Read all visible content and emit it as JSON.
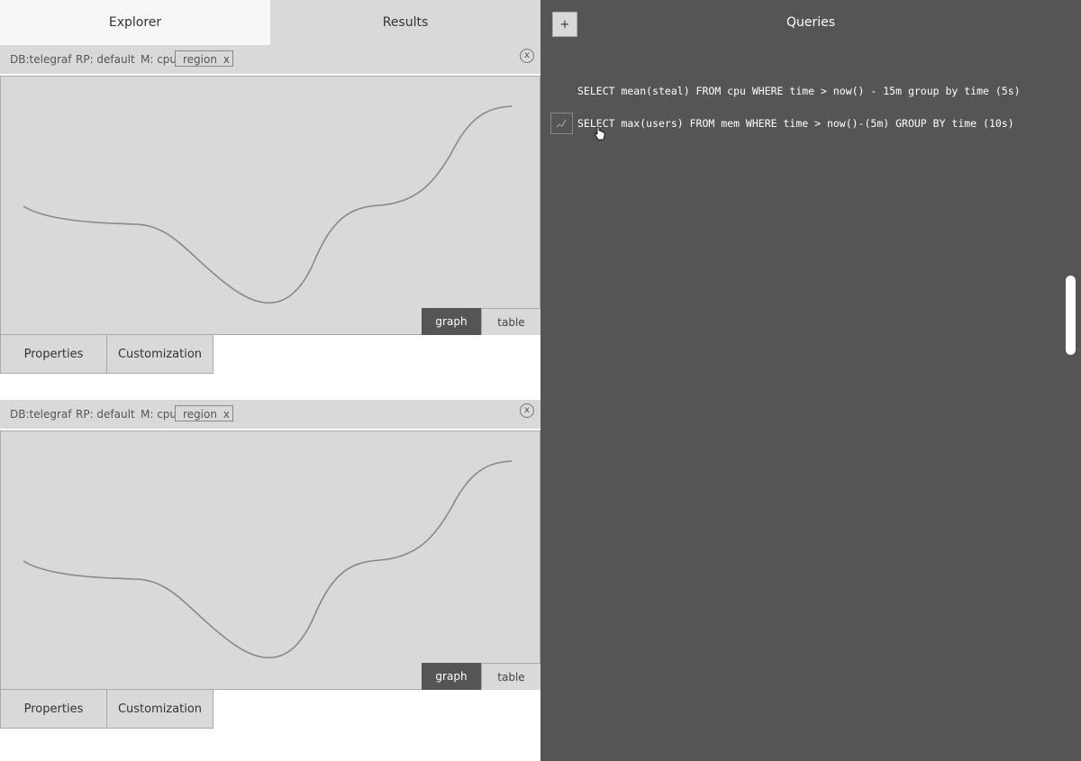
{
  "tabs": [
    {
      "label": "Explorer"
    },
    {
      "label": "Results"
    }
  ],
  "panels": [
    {
      "db": "DB:telegraf",
      "rp": "RP: default",
      "measurement": "M: cpu",
      "tag": "region",
      "tag_remove": "x",
      "close": "x",
      "view_buttons": {
        "graph": "graph",
        "table": "table"
      },
      "active_view": "graph",
      "properties_label": "Properties",
      "customization_label": "Customization"
    },
    {
      "db": "DB:telegraf",
      "rp": "RP: default",
      "measurement": "M: cpu",
      "tag": "region",
      "tag_remove": "x",
      "close": "x",
      "view_buttons": {
        "graph": "graph",
        "table": "table"
      },
      "active_view": "graph",
      "properties_label": "Properties",
      "customization_label": "Customization"
    }
  ],
  "queries": {
    "title": "Queries",
    "add_label": "+",
    "items": [
      {
        "text": "SELECT mean(steal) FROM cpu WHERE time > now() - 15m group by time (5s)"
      },
      {
        "text": "SELECT max(users) FROM mem WHERE time > now()-(5m) GROUP BY time (10s)"
      }
    ]
  },
  "icons": {
    "add": "plus-icon",
    "graph": "line-graph-icon",
    "cursor": "hand-cursor-icon"
  },
  "colors": {
    "dark_pane": "#555555",
    "light_panel": "#d9d9d9",
    "line": "#888888",
    "active_button": "#555555"
  }
}
